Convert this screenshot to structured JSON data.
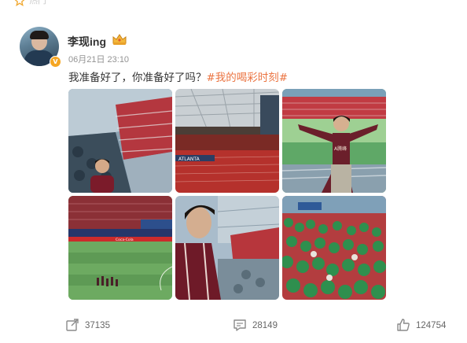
{
  "top": {
    "text": "热门"
  },
  "post": {
    "username": "李现ing",
    "time": "06月21日 23:10",
    "text_plain": "我准备好了，你准备好了吗？",
    "hashtag": "#我的喝彩时刻#",
    "verified_badge": "V"
  },
  "photos": [
    {
      "name": "photo-stadium-seats-man"
    },
    {
      "name": "photo-stadium-roof"
    },
    {
      "name": "photo-man-on-field"
    },
    {
      "name": "photo-pitch-players"
    },
    {
      "name": "photo-man-closeup"
    },
    {
      "name": "photo-crowd-green"
    }
  ],
  "photo_texts": {
    "jersey": "A腾峰",
    "atlanta": "ATLANTA",
    "coca": "Coca-Cola"
  },
  "actions": {
    "share_count": "37135",
    "comment_count": "28149",
    "like_count": "124754"
  },
  "icons": {
    "share": "share-icon",
    "comment": "comment-icon",
    "like": "like-icon",
    "crown": "crown-icon",
    "star": "star-icon"
  },
  "colors": {
    "hashtag": "#eb7340",
    "badge": "#f5a623",
    "text": "#333333",
    "muted": "#939393"
  }
}
